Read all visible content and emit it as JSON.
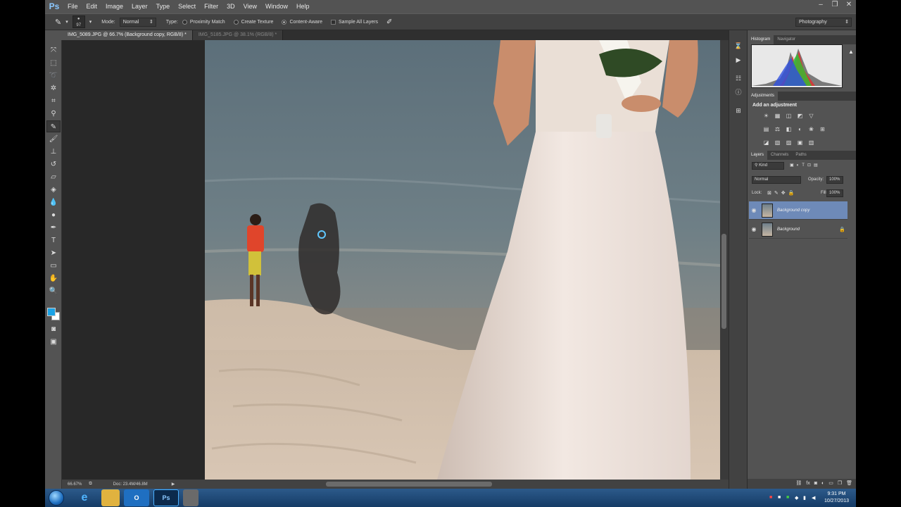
{
  "menubar": {
    "logo": "Ps",
    "items": [
      "File",
      "Edit",
      "Image",
      "Layer",
      "Type",
      "Select",
      "Filter",
      "3D",
      "View",
      "Window",
      "Help"
    ]
  },
  "options": {
    "brush_size": "97",
    "mode_label": "Mode:",
    "mode_value": "Normal",
    "type_label": "Type:",
    "type_options": [
      "Proximity Match",
      "Create Texture",
      "Content-Aware"
    ],
    "selected_type": "Content-Aware",
    "sample_all_layers": "Sample All Layers",
    "workspace": "Photography"
  },
  "tabs": [
    {
      "label": "IMG_5089.JPG @ 66.7% (Background copy, RGB/8) *",
      "active": true
    },
    {
      "label": "IMG_5185.JPG @ 38.1% (RGB/8) *",
      "active": false
    }
  ],
  "toolbar": {
    "tools": [
      "move-tool",
      "marquee-tool",
      "lasso-tool",
      "quick-selection-tool",
      "crop-tool",
      "eyedropper-tool",
      "spot-healing-brush-tool",
      "brush-tool",
      "clone-stamp-tool",
      "history-brush-tool",
      "eraser-tool",
      "gradient-tool",
      "blur-tool",
      "dodge-tool",
      "pen-tool",
      "type-tool",
      "path-selection-tool",
      "rectangle-tool",
      "hand-tool",
      "zoom-tool"
    ],
    "active_tool": "spot-healing-brush-tool",
    "foreground_color": "#1ba3e6",
    "background_color": "#ffffff"
  },
  "status": {
    "zoom": "66.67%",
    "doc": "Doc: 23.4M/46.8M"
  },
  "panels": {
    "histogram_tabs": [
      "Histogram",
      "Navigator"
    ],
    "adjustments_tab": "Adjustments",
    "add_adjustment": "Add an adjustment",
    "layers_tabs": [
      "Layers",
      "Channels",
      "Paths"
    ],
    "kind": "Kind",
    "blend_mode": "Normal",
    "opacity_label": "Opacity:",
    "opacity": "100%",
    "lock_label": "Lock:",
    "fill_label": "Fill:",
    "fill": "100%",
    "layers": [
      {
        "name": "Background copy",
        "selected": true,
        "locked": false
      },
      {
        "name": "Background",
        "selected": false,
        "locked": true
      }
    ]
  },
  "taskbar": {
    "apps": [
      "internet-explorer",
      "file-explorer",
      "outlook",
      "photoshop",
      "other-app"
    ],
    "time": "9:31 PM",
    "date": "10/27/2013"
  }
}
